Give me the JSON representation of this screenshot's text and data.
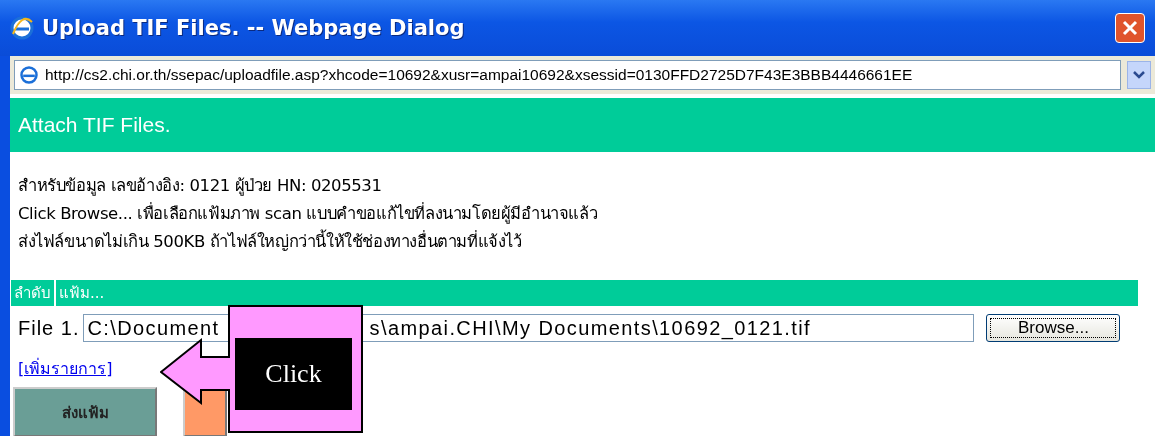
{
  "window": {
    "title": "Upload TIF Files. -- Webpage Dialog"
  },
  "address_bar": {
    "url": "http://cs2.chi.or.th/ssepac/uploadfile.asp?xhcode=10692&xusr=ampai10692&xsessid=0130FFD2725D7F43E3BBB4446661EE"
  },
  "header": {
    "title": "Attach TIF Files."
  },
  "info_lines": [
    "สำหรับข้อมูล เลขอ้างอิง: 0121 ผู้ป่วย HN: 0205531",
    "Click Browse... เพื่อเลือกแฟ้มภาพ scan แบบคำขอแก้ไขที่ลงนามโดยผู้มีอำนาจแล้ว",
    "ส่งไฟล์ขนาดไม่เกิน 500KB ถ้าไฟล์ใหญ่กว่านี้ให้ใช้ช่องทางอื่นตามที่แจ้งไว้"
  ],
  "table": {
    "columns": [
      "ลำดับ",
      "แฟ้ม..."
    ],
    "rows": [
      {
        "label": "File 1.",
        "value_start": "C:\\Document",
        "value_end": "s\\ampai.CHI\\My Documents\\10692_0121.tif",
        "browse": "Browse..."
      }
    ]
  },
  "add_link": "[เพิ่มรายการ]",
  "buttons": [
    {
      "kind": "submit",
      "label": "ส่งแฟ้ม"
    },
    {
      "kind": "other"
    }
  ],
  "callout": {
    "text": "Click"
  }
}
